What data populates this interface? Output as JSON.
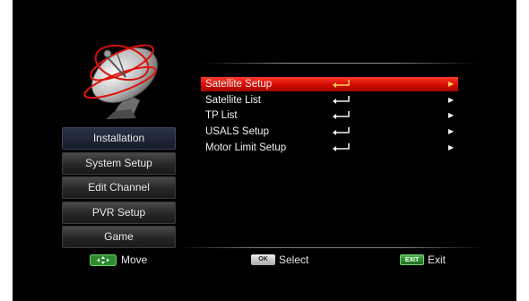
{
  "sidebar": {
    "items": [
      {
        "label": "Installation",
        "active": true
      },
      {
        "label": "System Setup"
      },
      {
        "label": "Edit Channel"
      },
      {
        "label": "PVR Setup"
      },
      {
        "label": "Game"
      }
    ]
  },
  "menu": {
    "items": [
      {
        "label": "Satellite Setup",
        "selected": true
      },
      {
        "label": "Satellite List"
      },
      {
        "label": "TP List"
      },
      {
        "label": "USALS Setup"
      },
      {
        "label": "Motor Limit Setup"
      }
    ],
    "selected_color": "#e5100a",
    "selected_arrow_color": "#ffd25a"
  },
  "footer": {
    "move": {
      "key": "move-keys-icon",
      "label": "Move"
    },
    "select": {
      "key": "OK",
      "label": "Select"
    },
    "exit": {
      "key": "EXIT",
      "label": "Exit"
    }
  },
  "colors": {
    "background": "#000000",
    "accent": "#e5100a",
    "side_active": "#1f2738"
  }
}
